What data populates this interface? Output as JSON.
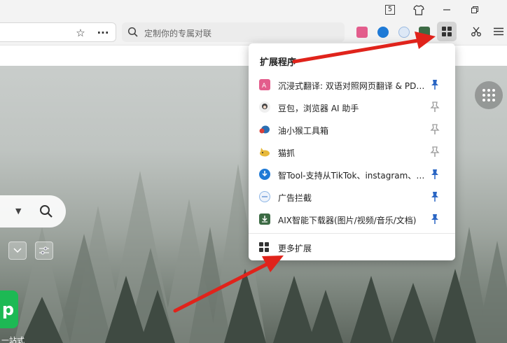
{
  "titlebar": {
    "badge_number": "5",
    "buttons": [
      "badge-icon",
      "shirt-icon",
      "minimize-icon",
      "restore-icon"
    ]
  },
  "toolbar": {
    "search_placeholder": "定制你的专属对联",
    "extensions_button_icon": "grid-icon",
    "cut_icon": "scissors-icon",
    "menu_icon": "hamburger-icon"
  },
  "popup": {
    "title": "扩展程序",
    "items": [
      {
        "label": "沉浸式翻译: 双语对照网页翻译 & PDF文档翻译",
        "icon": "immersive-translate-icon",
        "color": "#e35d8c",
        "pinned": true
      },
      {
        "label": "豆包，浏览器 AI 助手",
        "icon": "doubao-avatar-icon",
        "color": "#444444",
        "pinned": false
      },
      {
        "label": "油小猴工具箱",
        "icon": "tampermonkey-icon",
        "color": "#2a6fb3",
        "pinned": false
      },
      {
        "label": "猫抓",
        "icon": "cat-catch-icon",
        "color": "#e7b93b",
        "pinned": false
      },
      {
        "label": "智Tool-支持从TikTok、instagram、YouTube下载",
        "icon": "zhitool-download-icon",
        "color": "#1f7ad6",
        "pinned": true
      },
      {
        "label": "广告拦截",
        "icon": "adblock-icon",
        "color": "#8fb7e6",
        "pinned": true
      },
      {
        "label": "AIX智能下载器(图片/视频/音乐/文档)",
        "icon": "aix-downloader-icon",
        "color": "#3d6b45",
        "pinned": true
      }
    ],
    "more_label": "更多扩展"
  },
  "newtab": {
    "tile_letter": "p",
    "tile_label": "一站式"
  },
  "colors": {
    "arrow": "#e0231b",
    "pin_active": "#2b66c4",
    "pin_inactive": "#9a9a9a"
  }
}
